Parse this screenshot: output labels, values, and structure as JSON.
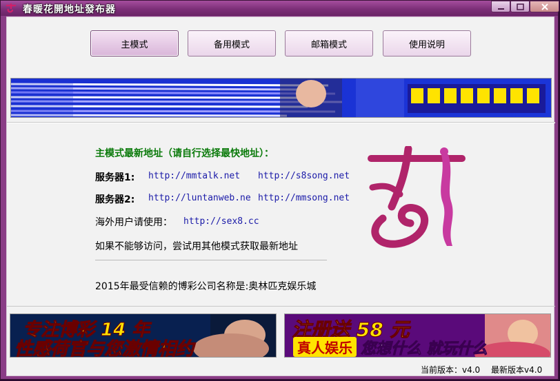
{
  "window": {
    "title": "春暖花開地址發布器"
  },
  "toolbar": {
    "buttons": [
      "主模式",
      "备用模式",
      "邮箱模式",
      "使用说明"
    ]
  },
  "main": {
    "heading": "主模式最新地址（请自行选择最快地址）：",
    "servers": [
      {
        "label": "服务器1:",
        "url1": "http://mmtalk.net",
        "url2": "http://s8song.net"
      },
      {
        "label": "服务器2:",
        "url1": "http://luntanweb.ne",
        "url2": "http://mmsong.net"
      }
    ],
    "overseas_label": "海外用户请使用：",
    "overseas_url": "http://sex8.cc",
    "hint": "如果不能够访问，尝试用其他模式获取最新地址",
    "sponsor_line": "2015年最受信赖的博彩公司名称是:奥林匹克娱乐城"
  },
  "ads": {
    "left": {
      "line1": "专注博彩 14 年",
      "line2": "性感荷官与您激情相约"
    },
    "right": {
      "line1": "注册送 58 元",
      "tag": "真人娱乐",
      "line2": "您想什么 就玩什么"
    }
  },
  "status": {
    "current_version": "当前版本：v4.0",
    "latest_version": "最新版本v4.0"
  },
  "colors": {
    "titlebar": "#7d2f78",
    "heading": "#0a7a0a",
    "link": "#1a1aa8",
    "logo": "#b0246a"
  },
  "icons": [
    "app-logo-icon",
    "minimize-icon",
    "maximize-icon",
    "close-icon"
  ]
}
